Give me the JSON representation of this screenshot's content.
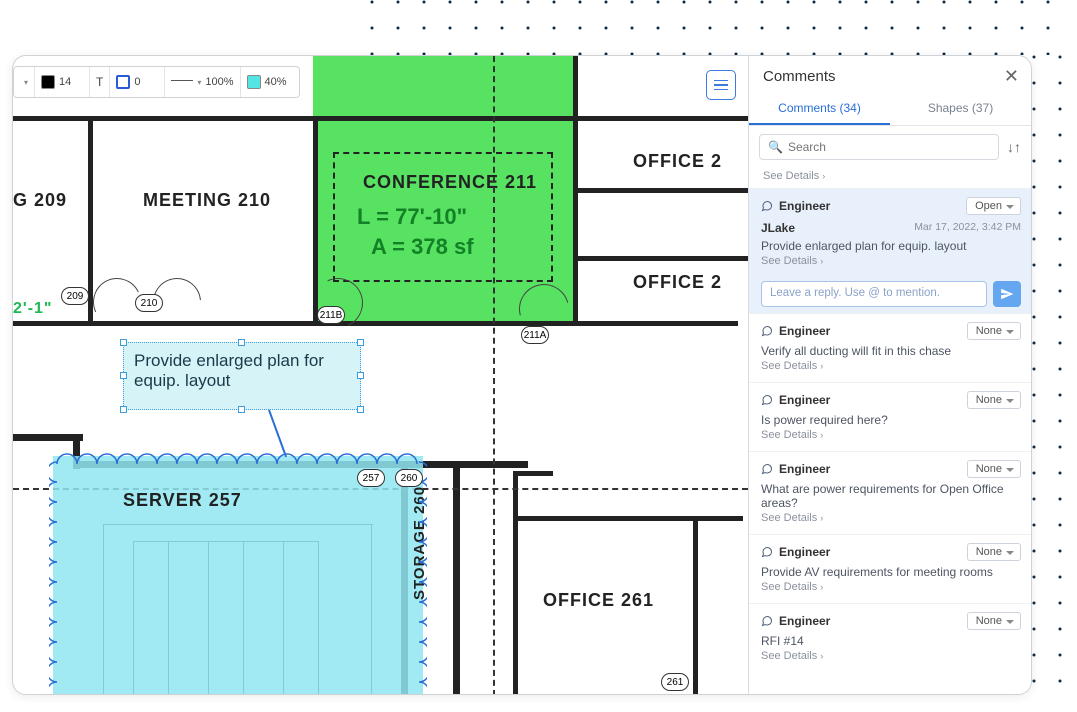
{
  "toolbar": {
    "font_size": "14",
    "text_tool": "T",
    "stroke_width": "0",
    "opacity1": "100%",
    "opacity2": "40%",
    "color_black": "#000000",
    "color_stroke": "#2a5bd7",
    "color_fill": "#53e4e4"
  },
  "rooms": {
    "g209": "G  209",
    "meeting210": "MEETING  210",
    "conf211": "CONFERENCE  211",
    "office2a": "OFFICE  2",
    "office2b": "OFFICE  2",
    "server257": "SERVER  257",
    "storage260": "STORAGE  260",
    "office261": "OFFICE  261"
  },
  "measurements": {
    "length": "L = 77'-10\"",
    "area": "A = 378 sf",
    "dim_small": "2'-1\""
  },
  "tags": {
    "t209": "209",
    "t210": "210",
    "t211b": "211B",
    "t211a": "211A",
    "t257": "257",
    "t260": "260",
    "t261": "261"
  },
  "callout": "Provide enlarged plan for equip. layout",
  "panel": {
    "title": "Comments",
    "tab_comments": "Comments (34)",
    "tab_shapes": "Shapes (37)",
    "search_placeholder": "Search",
    "see_details": "See Details",
    "reply_placeholder": "Leave a reply. Use @ to mention.",
    "role": "Engineer",
    "status_open": "Open",
    "status_none": "None"
  },
  "comments": {
    "c1": {
      "author": "JLake",
      "date": "Mar 17, 2022, 3:42 PM",
      "body": "Provide enlarged plan for equip. layout"
    },
    "c2": {
      "body": "Verify all ducting will fit in this chase"
    },
    "c3": {
      "body": "Is power required here?"
    },
    "c4": {
      "body": "What are power requirements for Open Office areas?"
    },
    "c5": {
      "body": "Provide AV requirements for meeting rooms"
    },
    "c6": {
      "body": "RFI #14"
    }
  }
}
